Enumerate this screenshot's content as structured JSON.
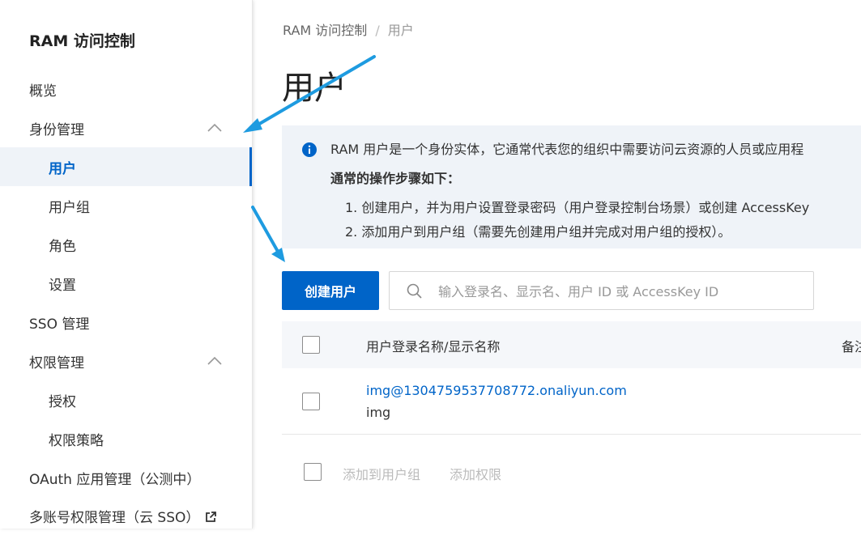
{
  "sidebar": {
    "title": "RAM 访问控制",
    "items": [
      {
        "label": "概览"
      },
      {
        "label": "身份管理"
      },
      {
        "label": "用户"
      },
      {
        "label": "用户组"
      },
      {
        "label": "角色"
      },
      {
        "label": "设置"
      },
      {
        "label": "SSO 管理"
      },
      {
        "label": "权限管理"
      },
      {
        "label": "授权"
      },
      {
        "label": "权限策略"
      },
      {
        "label": "OAuth 应用管理（公测中）"
      },
      {
        "label": "多账号权限管理（云 SSO）"
      }
    ]
  },
  "breadcrumb": {
    "root": "RAM 访问控制",
    "separator": "/",
    "current": "用户"
  },
  "page": {
    "title": "用户"
  },
  "info": {
    "intro": "RAM 用户是一个身份实体，它通常代表您的组织中需要访问云资源的人员或应用程",
    "steps_heading": "通常的操作步骤如下：",
    "steps": [
      "1. 创建用户，并为用户设置登录密码（用户登录控制台场景）或创建 AccessKey",
      "2. 添加用户到用户组（需要先创建用户组并完成对用户组的授权）。"
    ]
  },
  "toolbar": {
    "create_label": "创建用户",
    "search_placeholder": "输入登录名、显示名、用户 ID 或 AccessKey ID"
  },
  "table": {
    "columns": [
      "用户登录名称/显示名称",
      "备注"
    ],
    "rows": [
      {
        "login": "img@1304759537708772.onaliyun.com",
        "display": "img"
      }
    ]
  },
  "bulk": {
    "actions": [
      "添加到用户组",
      "添加权限"
    ]
  },
  "colors": {
    "accent": "#0064c8",
    "annotation_arrow": "#1e9be0",
    "info_bg": "#eff3f8"
  }
}
